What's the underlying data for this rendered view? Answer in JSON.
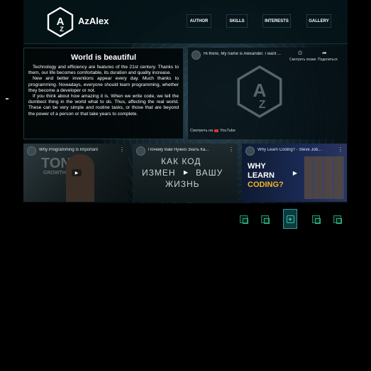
{
  "header": {
    "brand": "AzAlex",
    "nav": [
      "AUTHOR",
      "SKILLS",
      "INTERESTS",
      "GALLERY"
    ]
  },
  "text_card": {
    "title": "World is beautiful",
    "paragraphs": [
      "Technology and efficiency are features of the 21st century. Thanks to them, our life becomes comfortable, its duration and quality increase.",
      "New and better inventions appear every day. Much thanks to programming. Nowadays, everyone should learn programming, whether they become a developer or not.",
      "If you think about how amazing it is. When we write code, we tell the dumbest thing in the world what to do. Thus, affecting the real world. These can be very simple and routine tasks, or those that are beyond the power of a person or that take years to complete."
    ]
  },
  "videos": {
    "main": {
      "title": "Hi there, My name is Alexander. I want ...",
      "watch_later": "Смотреть позже",
      "share": "Поделиться",
      "watch_on": "Смотреть на",
      "platform": "YouTube"
    },
    "v1": {
      "title": "Why Programming Is Important",
      "overlay_text": "TONY",
      "overlay_sub": "GROWTH"
    },
    "v2": {
      "title": "Почему Вам Нужно Знать Ка...",
      "overlay_line1": "КАК КОД",
      "overlay_line2": "ИЗМЕН",
      "overlay_line2b": "ВАШУ",
      "overlay_line3": "ЖИЗНЬ"
    },
    "v3": {
      "title": "Why Learn Coding? - Steve Job...",
      "overlay_line1": "WHY",
      "overlay_line2": "LEARN",
      "overlay_line3": "CODING?"
    }
  },
  "colors": {
    "accent": "#27b583",
    "active": "#2a9aa0"
  }
}
